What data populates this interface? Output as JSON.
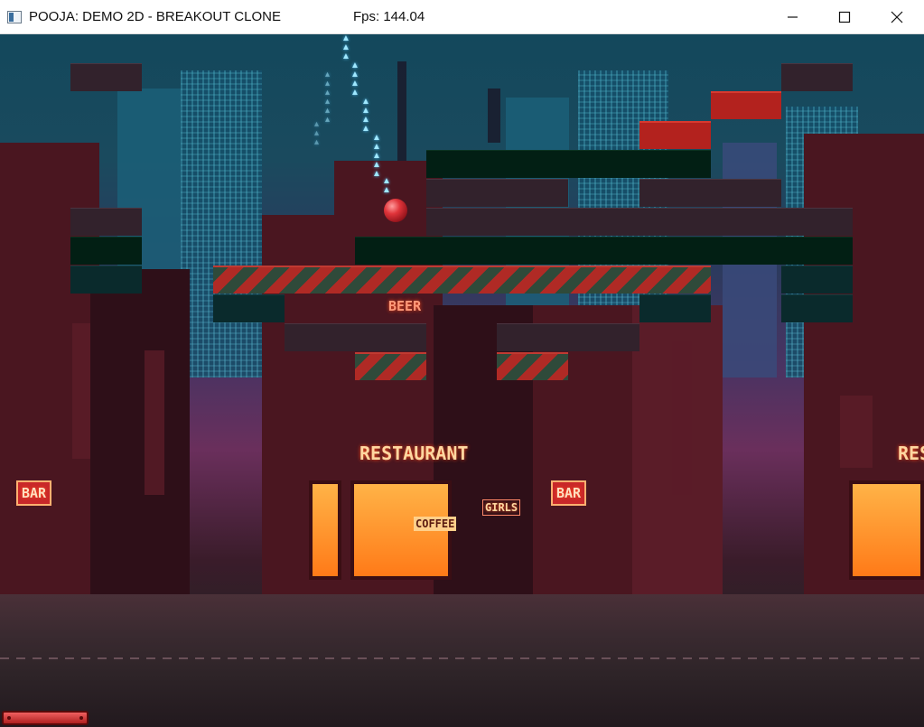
{
  "window": {
    "title": "POOJA: DEMO 2D - BREAKOUT CLONE",
    "fps_text": "Fps: 144.04"
  },
  "scene": {
    "signs": {
      "restaurant": "RESTAURANT",
      "bar_left": "BAR",
      "bar_right": "BAR",
      "beer": "BEER",
      "girls": "GIRLS",
      "coffee": "COFFEE",
      "rest_partial": "RES"
    }
  },
  "bricks": [
    {
      "type": "plum"
    },
    {
      "type": "plum"
    },
    {
      "type": "red"
    },
    {
      "type": "red"
    },
    {
      "type": "green"
    },
    {
      "type": "plum"
    },
    {
      "type": "plum"
    },
    {
      "type": "plum"
    },
    {
      "type": "plum"
    },
    {
      "type": "green"
    },
    {
      "type": "green"
    },
    {
      "type": "teal"
    },
    {
      "type": "solid"
    },
    {
      "type": "teal"
    },
    {
      "type": "teal"
    },
    {
      "type": "teal"
    },
    {
      "type": "plum"
    },
    {
      "type": "plum"
    },
    {
      "type": "solid"
    },
    {
      "type": "solid"
    }
  ],
  "colors": {
    "brick_red": "#b3221e",
    "brick_plum": "#32222c",
    "brick_green": "#021f14",
    "brick_teal": "#0a2a2c",
    "ball": "#e0343a",
    "paddle": "#d03a3a"
  }
}
